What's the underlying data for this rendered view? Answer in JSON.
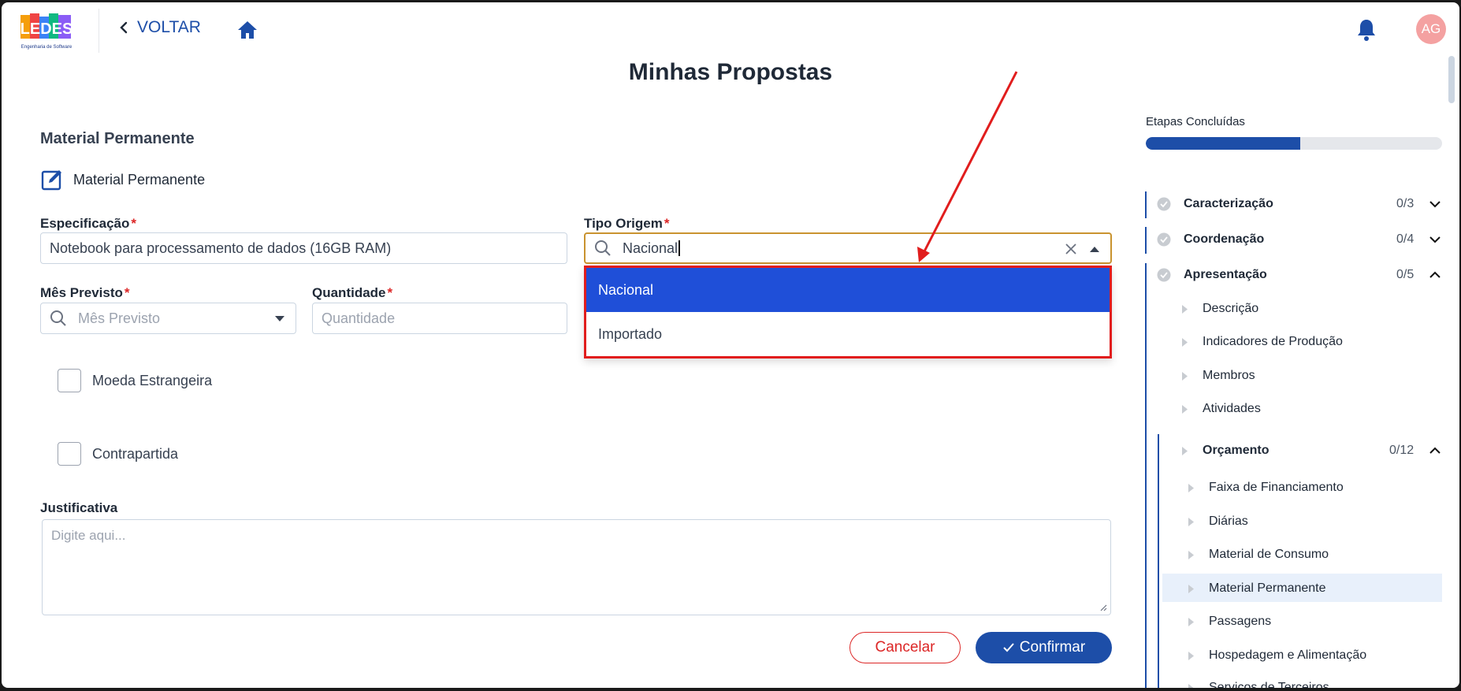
{
  "header": {
    "back_label": "VOLTAR",
    "avatar_initials": "AG",
    "logo_text": "Engenharia de Software"
  },
  "page_title": "Minhas Propostas",
  "form": {
    "section_title": "Material Permanente",
    "sub_title": "Material Permanente",
    "especificacao": {
      "label": "Especificação",
      "value": "Notebook para processamento de dados (16GB RAM)"
    },
    "tipo_origem": {
      "label": "Tipo Origem",
      "value": "Nacional",
      "options": [
        {
          "label": "Nacional",
          "selected": true
        },
        {
          "label": "Importado",
          "selected": false
        }
      ]
    },
    "mes_previsto": {
      "label": "Mês Previsto",
      "placeholder": "Mês Previsto"
    },
    "quantidade": {
      "label": "Quantidade",
      "placeholder": "Quantidade"
    },
    "moeda_estrangeira": "Moeda Estrangeira",
    "contrapartida": "Contrapartida",
    "justificativa": {
      "label": "Justificativa",
      "placeholder": "Digite aqui..."
    },
    "cancel_label": "Cancelar",
    "confirm_label": "Confirmar"
  },
  "sidebar": {
    "steps_label": "Etapas Concluídas",
    "progress_fraction": 0.52,
    "sections": [
      {
        "name": "Caracterização",
        "count": "0/3",
        "expanded": false
      },
      {
        "name": "Coordenação",
        "count": "0/4",
        "expanded": false
      },
      {
        "name": "Apresentação",
        "count": "0/5",
        "expanded": true
      }
    ],
    "apresentacao_items": [
      "Descrição",
      "Indicadores de Produção",
      "Membros",
      "Atividades"
    ],
    "orcamento": {
      "name": "Orçamento",
      "count": "0/12",
      "expanded": true
    },
    "orcamento_items": [
      "Faixa de Financiamento",
      "Diárias",
      "Material de Consumo",
      "Material Permanente",
      "Passagens",
      "Hospedagem e Alimentação",
      "Serviços de Terceiros"
    ],
    "active_item": "Material Permanente"
  },
  "colors": {
    "primary": "#1d4ea8",
    "dropdown_active": "#1f4fd8",
    "danger": "#dc2626",
    "annotation": "#e11d1d"
  }
}
